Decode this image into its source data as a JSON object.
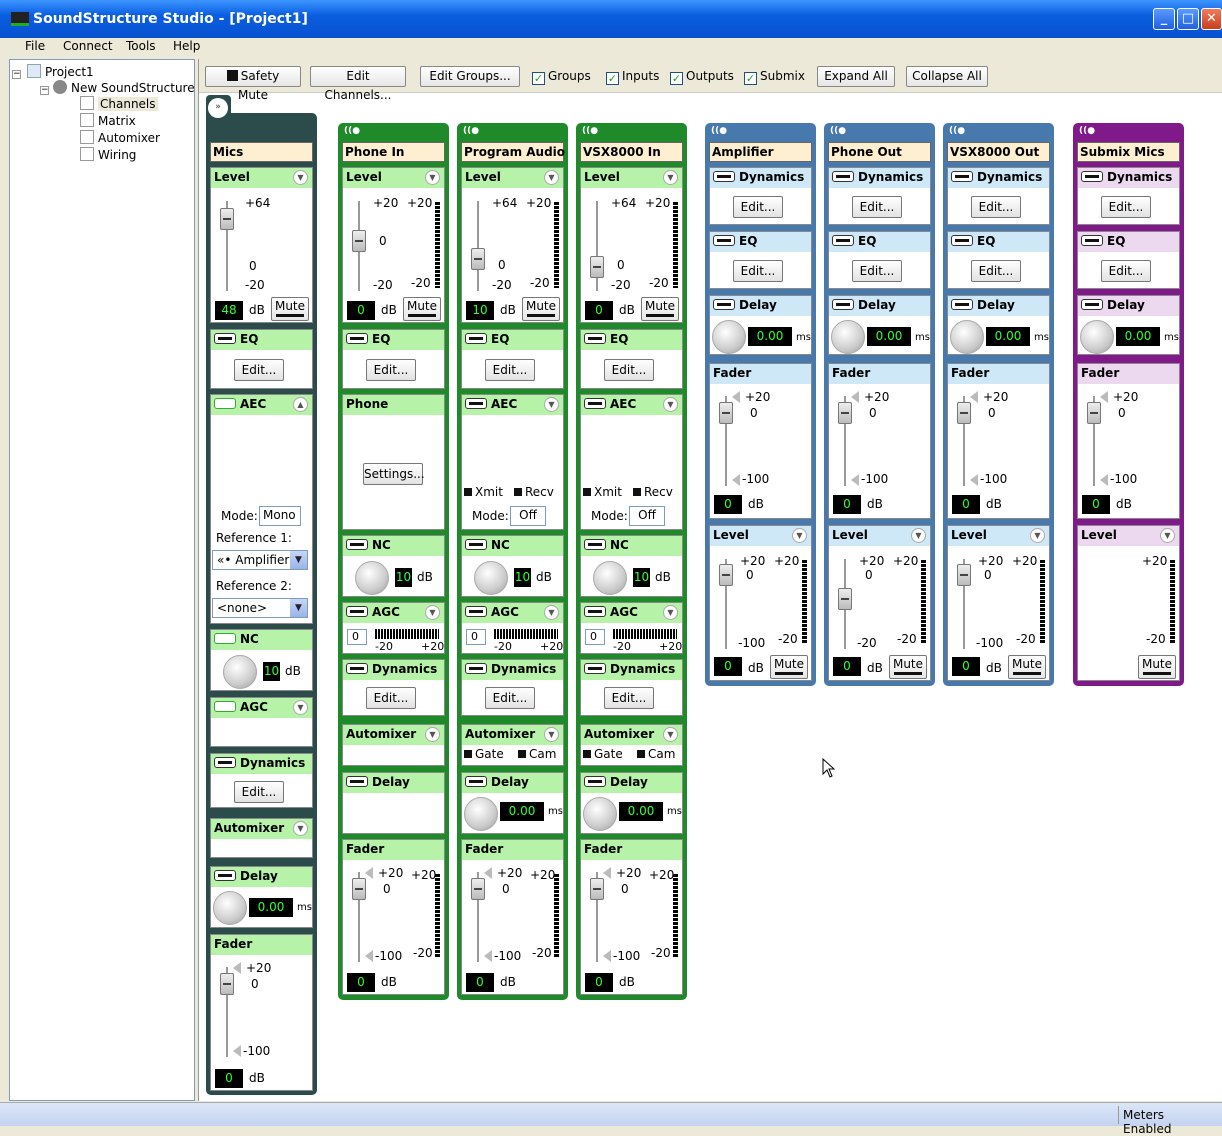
{
  "window": {
    "title": "SoundStructure Studio - [Project1]",
    "minimize": "_",
    "maximize": "□",
    "close": "✕"
  },
  "menu": [
    "File",
    "Connect",
    "Tools",
    "Help"
  ],
  "tree": {
    "project": "Project1",
    "device": "New SoundStructure",
    "items": [
      "Channels",
      "Matrix",
      "Automixer",
      "Wiring"
    ],
    "selected": "Channels"
  },
  "toolbar": {
    "safety_mute": "Safety Mute",
    "edit_channels": "Edit Channels...",
    "edit_groups": "Edit Groups...",
    "groups": "Groups",
    "inputs": "Inputs",
    "outputs": "Outputs",
    "submix": "Submix",
    "expand_all": "Expand All",
    "collapse_all": "Collapse All"
  },
  "common": {
    "level": "Level",
    "eq": "EQ",
    "aec": "AEC",
    "nc": "NC",
    "agc": "AGC",
    "dynamics": "Dynamics",
    "automixer": "Automixer",
    "delay": "Delay",
    "fader": "Fader",
    "phone": "Phone",
    "edit": "Edit...",
    "settings": "Settings...",
    "mute": "Mute",
    "db": "dB",
    "ms": "ms",
    "mode": "Mode:",
    "xmit": "Xmit",
    "recv": "Recv",
    "gate": "Gate",
    "cam": "Cam",
    "p64": "+64",
    "p20": "+20",
    "zero": "0",
    "m20": "-20",
    "m100": "-100",
    "agc_min": "-20",
    "agc_max": "+20",
    "agc_val": "0"
  },
  "mics": {
    "name": "Mics",
    "level_value": "48",
    "fader_value": "0",
    "nc_value": "10",
    "delay_value": "0.00",
    "mode_value": "Mono",
    "ref1_label": "Reference 1:",
    "ref1_value": "«• Amplifier",
    "ref2_label": "Reference 2:",
    "ref2_value": "<none>"
  },
  "inputs": [
    {
      "name": "Phone In",
      "level_value": "0",
      "level_top": "+20",
      "fader_value": "0",
      "nc_value": "10"
    },
    {
      "name": "Program Audio",
      "level_value": "10",
      "level_top": "+64",
      "fader_value": "0",
      "nc_value": "10",
      "mode_value": "Off",
      "delay_value": "0.00"
    },
    {
      "name": "VSX8000 In",
      "level_value": "0",
      "level_top": "+64",
      "fader_value": "0",
      "nc_value": "10",
      "mode_value": "Off",
      "delay_value": "0.00"
    }
  ],
  "outputs": [
    {
      "name": "Amplifier",
      "delay_value": "0.00",
      "fader_value": "0",
      "level_value": "0",
      "level_bottom": "-100"
    },
    {
      "name": "Phone Out",
      "delay_value": "0.00",
      "fader_value": "0",
      "level_value": "0",
      "level_bottom": "-20"
    },
    {
      "name": "VSX8000 Out",
      "delay_value": "0.00",
      "fader_value": "0",
      "level_value": "0",
      "level_bottom": "-100"
    }
  ],
  "submix": {
    "name": "Submix Mics",
    "delay_value": "0.00",
    "fader_value": "0"
  },
  "status": {
    "meters": "Meters Enabled"
  },
  "colors": {
    "mics": "#2c4c4c",
    "input": "#1e8a2a",
    "output": "#4779ad",
    "submix": "#80198a"
  }
}
